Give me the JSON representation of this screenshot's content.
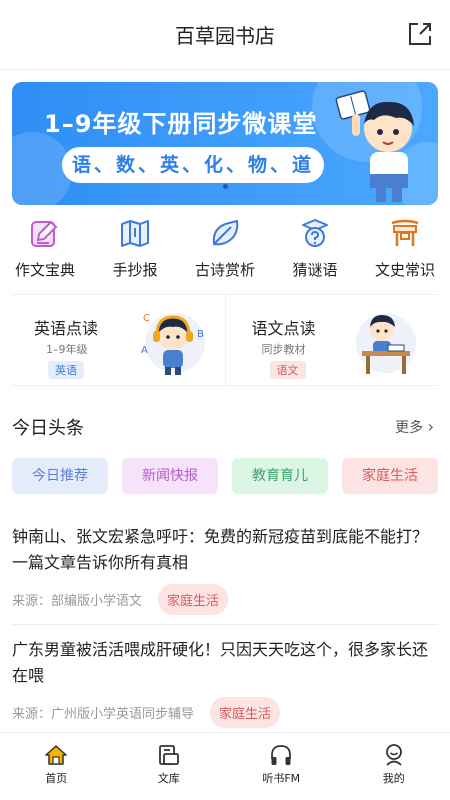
{
  "header": {
    "title": "百草园书店"
  },
  "banner": {
    "title": "1–9年级下册同步微课堂",
    "subjects": "语、数、英、化、物、道"
  },
  "quick": [
    {
      "label": "作文宝典",
      "icon": "pen-edit-icon",
      "color": "#c05bd6"
    },
    {
      "label": "手抄报",
      "icon": "map-book-icon",
      "color": "#3f79d9"
    },
    {
      "label": "古诗赏析",
      "icon": "leaf-icon",
      "color": "#3f79d9"
    },
    {
      "label": "猜谜语",
      "icon": "question-cap-icon",
      "color": "#3f79d9"
    },
    {
      "label": "文史常识",
      "icon": "ancient-gate-icon",
      "color": "#e2761f"
    }
  ],
  "cards": [
    {
      "title": "英语点读",
      "sub": "1–9年级",
      "tag": "英语",
      "tag_color": "#3f79d9",
      "tag_bg": "#e4edfb"
    },
    {
      "title": "语文点读",
      "sub": "同步教材",
      "tag": "语文",
      "tag_color": "#d85b5b",
      "tag_bg": "#fde4e4"
    }
  ],
  "section": {
    "title": "今日头条",
    "more": "更多"
  },
  "tabs": [
    {
      "label": "今日推荐",
      "color": "#5b7fd6",
      "bg": "#e4ebfb"
    },
    {
      "label": "新闻快报",
      "color": "#b65bc9",
      "bg": "#f6e3fb"
    },
    {
      "label": "教育育儿",
      "color": "#3aa56a",
      "bg": "#dcf6e6"
    },
    {
      "label": "家庭生活",
      "color": "#d85b5b",
      "bg": "#fde4e4"
    }
  ],
  "articles": [
    {
      "title": "钟南山、张文宏紧急呼吁：免费的新冠疫苗到底能不能打？一篇文章告诉你所有真相",
      "source": "来源：部编版小学语文",
      "tag": "家庭生活"
    },
    {
      "title": "广东男童被活活喂成肝硬化！只因天天吃这个，很多家长还在喂",
      "source": "来源：广州版小学英语同步辅导",
      "tag": "家庭生活"
    }
  ],
  "nav": [
    {
      "label": "首页",
      "icon": "home-icon",
      "active": true
    },
    {
      "label": "文库",
      "icon": "library-icon"
    },
    {
      "label": "听书FM",
      "icon": "headphones-icon"
    },
    {
      "label": "我的",
      "icon": "profile-icon"
    }
  ],
  "colors": {
    "accent": "#2f8ef5",
    "home_active": "#f5b400"
  }
}
